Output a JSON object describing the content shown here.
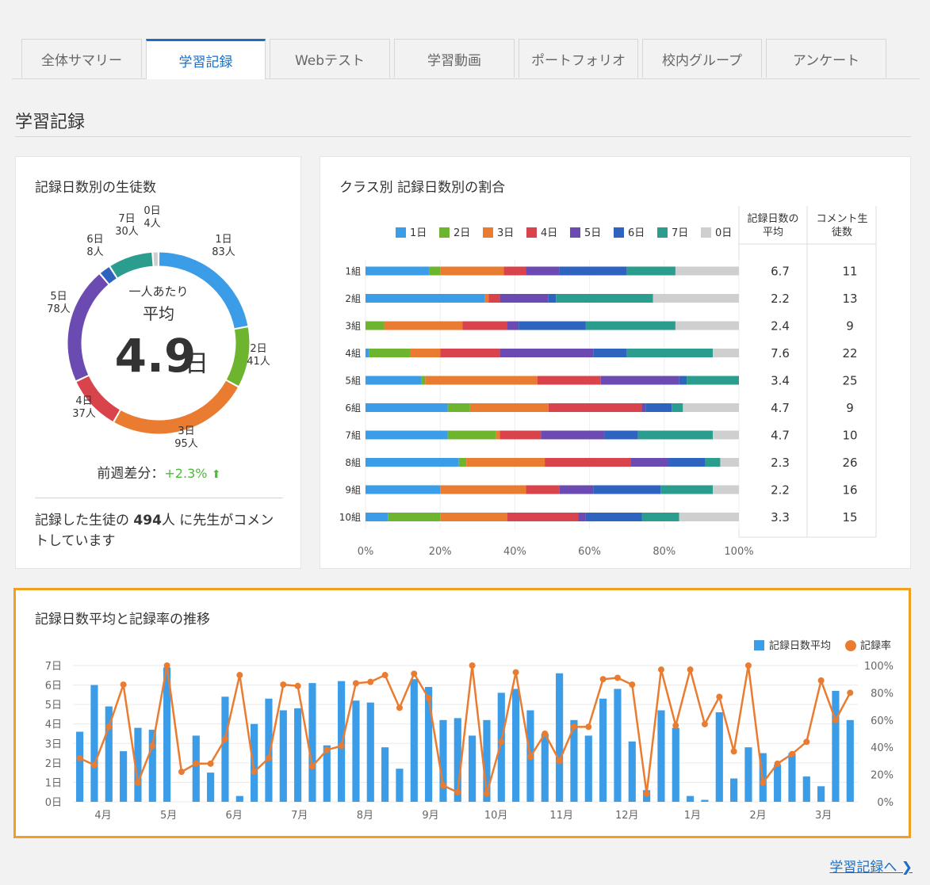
{
  "tabs": [
    "全体サマリー",
    "学習記録",
    "Webテスト",
    "学習動画",
    "ポートフォリオ",
    "校内グループ",
    "アンケート"
  ],
  "active_tab": 1,
  "section_title": "学習記録",
  "left_card": {
    "title": "記録日数別の生徒数",
    "center_line1": "一人あたり",
    "center_line2": "平均",
    "center_value": "4.9",
    "center_unit": "日",
    "segments": [
      {
        "label": "1日",
        "count": "83人",
        "value": 83,
        "color": "#3b9de8"
      },
      {
        "label": "2日",
        "count": "41人",
        "value": 41,
        "color": "#6db42f"
      },
      {
        "label": "3日",
        "count": "95人",
        "value": 95,
        "color": "#ea7c32"
      },
      {
        "label": "4日",
        "count": "37人",
        "value": 37,
        "color": "#d9434b"
      },
      {
        "label": "5日",
        "count": "78人",
        "value": 78,
        "color": "#6b4bb2"
      },
      {
        "label": "6日",
        "count": "8人",
        "value": 8,
        "color": "#2e63c0"
      },
      {
        "label": "7日",
        "count": "30人",
        "value": 30,
        "color": "#2a9d8f"
      },
      {
        "label": "0日",
        "count": "4人",
        "value": 4,
        "color": "#cfcfcf"
      }
    ],
    "weekly_diff_label": "前週差分：",
    "weekly_diff_value": "+2.3%",
    "note_prefix": "記録した生徒の",
    "note_count": "494",
    "note_suffix": "人 に先生がコメントしています"
  },
  "class_card": {
    "title": "クラス別 記録日数別の割合",
    "col_avg_header": "記録日数の平均",
    "col_comment_header": "コメント生徒数",
    "legend": [
      {
        "name": "1日",
        "color": "#3b9de8"
      },
      {
        "name": "2日",
        "color": "#6db42f"
      },
      {
        "name": "3日",
        "color": "#ea7c32"
      },
      {
        "name": "4日",
        "color": "#d9434b"
      },
      {
        "name": "5日",
        "color": "#6b4bb2"
      },
      {
        "name": "6日",
        "color": "#2e63c0"
      },
      {
        "name": "7日",
        "color": "#2a9d8f"
      },
      {
        "name": "0日",
        "color": "#cfcfcf"
      }
    ],
    "x_ticks": [
      "0%",
      "20%",
      "40%",
      "60%",
      "80%",
      "100%"
    ]
  },
  "trend_card": {
    "title": "記録日数平均と記録率の推移",
    "legend_bar": "記録日数平均",
    "legend_line": "記録率",
    "bar_color": "#3b9de8",
    "line_color": "#ea7c32",
    "highlight_color": "#f0a020"
  },
  "chart_data": [
    {
      "type": "pie",
      "title": "記録日数別の生徒数",
      "categories": [
        "1日",
        "2日",
        "3日",
        "4日",
        "5日",
        "6日",
        "7日",
        "0日"
      ],
      "values": [
        83,
        41,
        95,
        37,
        78,
        8,
        30,
        4
      ]
    },
    {
      "type": "bar",
      "stacked": true,
      "orientation": "horizontal",
      "title": "クラス別 記録日数別の割合",
      "categories": [
        "1組",
        "2組",
        "3組",
        "4組",
        "5組",
        "6組",
        "7組",
        "8組",
        "9組",
        "10組"
      ],
      "series": [
        {
          "name": "1日",
          "values": [
            17,
            32,
            0,
            1,
            15,
            22,
            22,
            25,
            20,
            6
          ]
        },
        {
          "name": "2日",
          "values": [
            3,
            0,
            5,
            11,
            1,
            6,
            13,
            2,
            0,
            14
          ]
        },
        {
          "name": "3日",
          "values": [
            17,
            1,
            21,
            8,
            30,
            21,
            1,
            21,
            23,
            18
          ]
        },
        {
          "name": "4日",
          "values": [
            6,
            3,
            12,
            16,
            17,
            25,
            11,
            23,
            9,
            19
          ]
        },
        {
          "name": "5日",
          "values": [
            9,
            13,
            3,
            25,
            21,
            1,
            17,
            10,
            9,
            2
          ]
        },
        {
          "name": "6日",
          "values": [
            18,
            2,
            18,
            9,
            2,
            7,
            9,
            10,
            18,
            15
          ]
        },
        {
          "name": "7日",
          "values": [
            13,
            26,
            24,
            23,
            14,
            3,
            20,
            4,
            14,
            10
          ]
        },
        {
          "name": "0日",
          "values": [
            17,
            23,
            17,
            7,
            0,
            15,
            7,
            5,
            7,
            16
          ]
        }
      ],
      "avg_days": [
        "6.7",
        "2.2",
        "2.4",
        "7.6",
        "3.4",
        "4.7",
        "4.7",
        "2.3",
        "2.2",
        "3.3"
      ],
      "comment_students": [
        "11",
        "13",
        "9",
        "22",
        "25",
        "9",
        "10",
        "26",
        "16",
        "15"
      ],
      "xlim": [
        0,
        100
      ]
    },
    {
      "type": "bar",
      "title": "記録日数平均と記録率の推移",
      "x_labels": [
        "4月",
        "5月",
        "6月",
        "7月",
        "8月",
        "9月",
        "10月",
        "11月",
        "12月",
        "1月",
        "2月",
        "3月"
      ],
      "y_left_ticks": [
        "0日",
        "1日",
        "2日",
        "3日",
        "4日",
        "5日",
        "6日",
        "7日"
      ],
      "y_right_ticks": [
        "0%",
        "20%",
        "40%",
        "60%",
        "80%",
        "100%"
      ],
      "ylim_left": [
        0,
        7
      ],
      "ylim_right": [
        0,
        100
      ],
      "series": [
        {
          "name": "記録日数平均",
          "type": "bar",
          "values": [
            3.6,
            6.0,
            4.9,
            2.6,
            3.8,
            3.7,
            6.9,
            0,
            3.4,
            1.5,
            5.4,
            0.3,
            4.0,
            5.3,
            4.7,
            4.8,
            6.1,
            2.9,
            6.2,
            5.2,
            5.1,
            2.8,
            1.7,
            6.3,
            5.9,
            4.2,
            4.3,
            3.4,
            4.2,
            5.6,
            5.8,
            4.7,
            3.5,
            6.6,
            4.2,
            3.4,
            5.3,
            5.8,
            3.1,
            0.6,
            4.7,
            3.8,
            0.3,
            0.1,
            4.6,
            1.2,
            2.8,
            2.5,
            1.9,
            2.5,
            1.3,
            0.8,
            5.7,
            4.2
          ]
        },
        {
          "name": "記録率",
          "type": "line",
          "values": [
            32,
            27,
            55,
            86,
            14,
            41,
            100,
            22,
            28,
            28,
            46,
            93,
            22,
            32,
            86,
            85,
            26,
            38,
            41,
            87,
            88,
            93,
            69,
            94,
            76,
            12,
            7,
            100,
            6,
            44,
            95,
            33,
            50,
            30,
            55,
            55,
            90,
            91,
            86,
            6,
            97,
            56,
            97,
            57,
            77,
            37,
            100,
            14,
            28,
            35,
            44,
            89,
            60,
            80
          ]
        }
      ]
    }
  ]
}
